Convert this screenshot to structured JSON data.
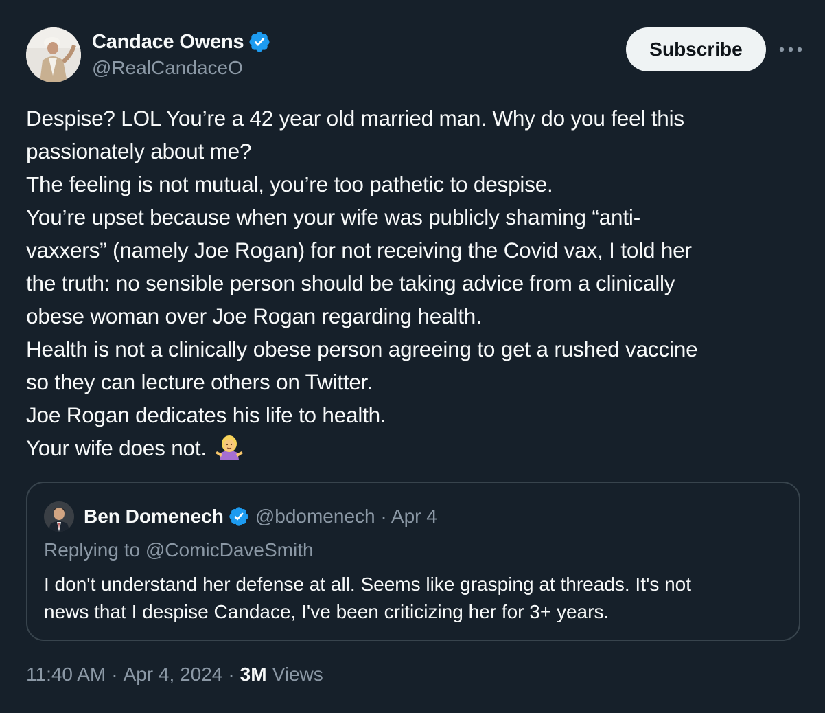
{
  "author": {
    "display_name": "Candace Owens",
    "handle": "@RealCandaceO",
    "verified": true
  },
  "actions": {
    "subscribe_label": "Subscribe",
    "more_icon": "more-horizontal-icon"
  },
  "tweet": {
    "lines": [
      "Despise? LOL You’re a 42 year old married man. Why do you feel this",
      "passionately about me?",
      "The feeling is not mutual, you’re too pathetic to despise.",
      "You’re upset because when your wife was publicly shaming “anti-",
      "vaxxers” (namely Joe Rogan) for not receiving the Covid vax, I told her",
      "the truth: no sensible person should be taking advice from a clinically",
      "obese woman over Joe Rogan regarding health.",
      "Health is not a clinically obese person agreeing to get a rushed vaccine",
      "so they can lecture others on Twitter.",
      "Joe Rogan dedicates his life to health.",
      "Your wife does not."
    ],
    "trailing_emoji": "person-shrugging-emoji"
  },
  "quote": {
    "display_name": "Ben Domenech",
    "handle_date": "@bdomenech · Apr 4",
    "replying_to": "Replying to @ComicDaveSmith",
    "lines": [
      "I don't understand her defense at all. Seems like grasping at threads. It's not",
      "news that I despise Candace, I've been criticizing her for 3+ years."
    ]
  },
  "footer": {
    "time": "11:40 AM",
    "date": "Apr 4, 2024",
    "views_count": "3M",
    "views_label": "Views"
  },
  "colors": {
    "background": "#16202a",
    "text": "#f7f9f9",
    "muted": "#8b98a5",
    "verified": "#1d9bf0",
    "border": "#38444d"
  }
}
